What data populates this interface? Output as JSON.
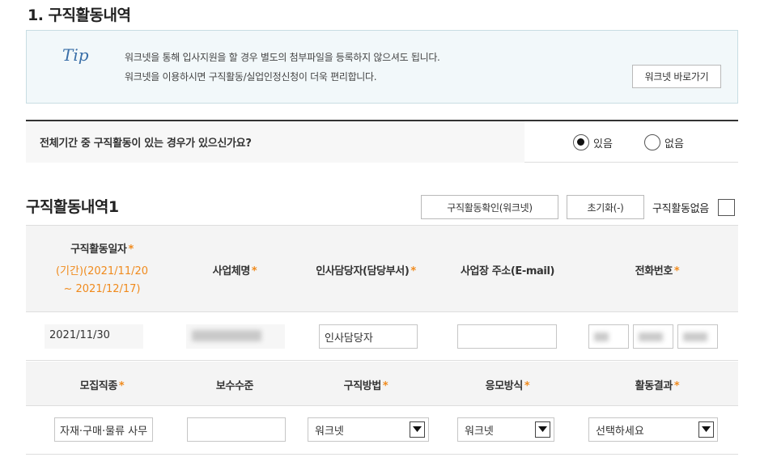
{
  "section": {
    "title": "1. 구직활동내역"
  },
  "tip": {
    "label": "Tip",
    "line1": "워크넷을 통해 입사지원을 할 경우 별도의 첨부파일을 등록하지 않으셔도 됩니다.",
    "line2": "워크넷을 이용하시면 구직활동/실업인정신청이 더욱 편리합니다.",
    "button": "워크넷 바로가기"
  },
  "question": {
    "text": "전체기간 중 구직활동이 있는 경우가 있으신가요?",
    "options": [
      {
        "label": "있음",
        "checked": true
      },
      {
        "label": "없음",
        "checked": false
      }
    ]
  },
  "activity": {
    "title": "구직활동내역1",
    "check_button": "구직활동확인(워크넷)",
    "reset_button": "초기화(-)",
    "none_label": "구직활동없음",
    "header1": {
      "date_label": "구직활동일자",
      "period_line1": "(기간)(2021/11/20",
      "period_line2": "~ 2021/12/17)",
      "company": "사업체명",
      "hr": "인사담당자(담당부서)",
      "address": "사업장 주소(E-mail)",
      "phone": "전화번호"
    },
    "row1": {
      "date": "2021/11/30",
      "hr_value": "인사담당자",
      "address_value": ""
    },
    "header2": {
      "job_type": "모집직종",
      "salary": "보수수준",
      "method": "구직방법",
      "apply": "응모방식",
      "result": "활동결과"
    },
    "row2": {
      "job_type_value": "자재·구매·물류 사무",
      "salary_value": "",
      "method_value": "워크넷",
      "apply_value": "워크넷",
      "result_value": "선택하세요"
    },
    "required_mark": "*"
  }
}
